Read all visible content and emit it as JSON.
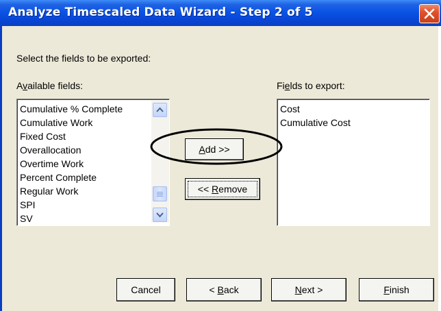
{
  "window": {
    "title": "Analyze Timescaled Data Wizard - Step 2 of 5"
  },
  "instructions": "Select the fields to be exported:",
  "available": {
    "label_pre": "A",
    "label_ul": "v",
    "label_post": "ailable fields:",
    "items": [
      "Cumulative % Complete",
      "Cumulative Work",
      "Fixed Cost",
      "Overallocation",
      "Overtime Work",
      "Percent Complete",
      "Regular Work",
      "SPI",
      "SV"
    ]
  },
  "export": {
    "label_pre": "Fi",
    "label_ul": "e",
    "label_post": "lds to export:",
    "items": [
      "Cost",
      "Cumulative Cost"
    ]
  },
  "buttons": {
    "add_ul": "A",
    "add_post": "dd >>",
    "remove_pre": "<< ",
    "remove_ul": "R",
    "remove_post": "emove",
    "cancel": "Cancel",
    "back_pre": "< ",
    "back_ul": "B",
    "back_post": "ack",
    "next_ul": "N",
    "next_post": "ext >",
    "finish_ul": "F",
    "finish_post": "inish"
  },
  "icons": {
    "close": "close-x-icon",
    "scroll_up": "arrow-up-icon",
    "scroll_down": "arrow-down-icon"
  },
  "colors": {
    "titlebar": "#0a54e6",
    "dialog_bg": "#ece9d8",
    "close_button": "#e0522c"
  }
}
